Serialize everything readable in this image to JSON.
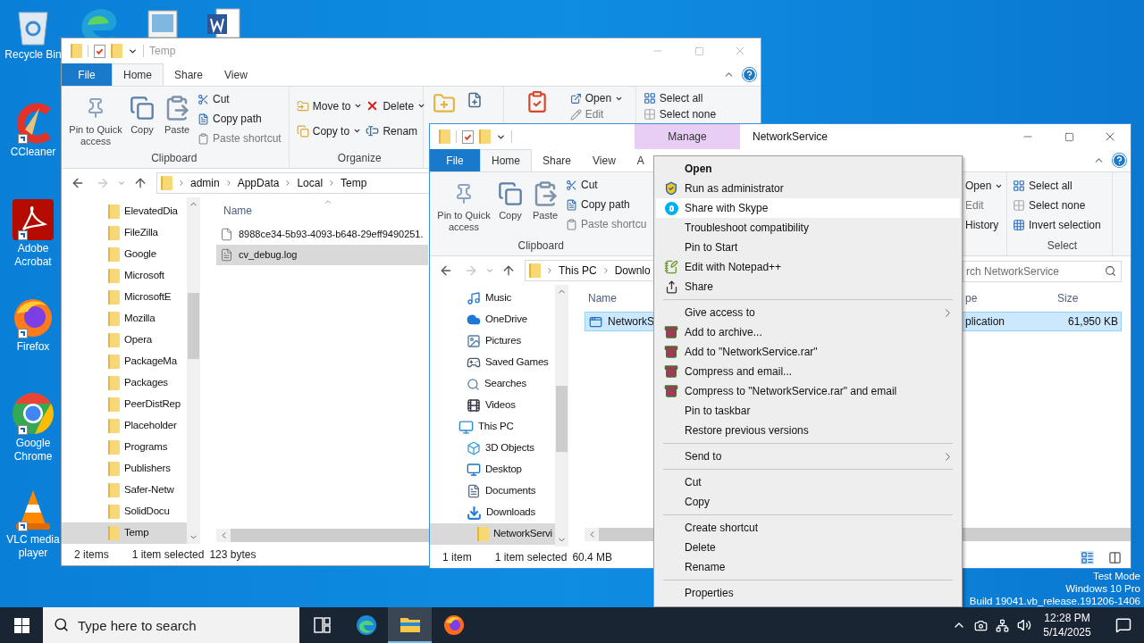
{
  "desktop_icons": [
    {
      "label": "Recycle Bin",
      "kind": "recycle"
    },
    {
      "label": "CCleaner",
      "kind": "ccleaner"
    },
    {
      "label": "Adobe Acrobat",
      "kind": "acrobat"
    },
    {
      "label": "Firefox",
      "kind": "firefox"
    },
    {
      "label": "Google Chrome",
      "kind": "chrome"
    },
    {
      "label": "VLC media player",
      "kind": "vlc"
    }
  ],
  "temp_window": {
    "title": "Temp",
    "tabs": [
      {
        "label": "File",
        "kind": "file",
        "selected": false
      },
      {
        "label": "Home",
        "kind": "tab",
        "selected": true
      },
      {
        "label": "Share",
        "kind": "tab",
        "selected": false
      },
      {
        "label": "View",
        "kind": "tab",
        "selected": false
      }
    ],
    "clipboard": {
      "large": [
        "Pin to Quick access",
        "Copy",
        "Paste"
      ],
      "small": [
        "Cut",
        "Copy path",
        "Paste shortcut"
      ],
      "label": "Clipboard"
    },
    "organize": {
      "items": [
        {
          "label": "Move to",
          "kind": "dropdown"
        },
        {
          "label": "Copy to",
          "kind": "dropdown"
        },
        {
          "label": "Delete",
          "kind": "dropdown"
        },
        {
          "label": "Renam",
          "kind": "button"
        }
      ],
      "label": "Organize"
    },
    "open": [
      {
        "label": "Open",
        "kind": "dropdown"
      },
      {
        "label": "Edit",
        "kind": "button"
      }
    ],
    "select": [
      "Select all",
      "Select none"
    ],
    "path": [
      "admin",
      "AppData",
      "Local",
      "Temp"
    ],
    "nav": [
      {
        "label": "ElevatedDia",
        "selected": false
      },
      {
        "label": "FileZilla",
        "selected": false
      },
      {
        "label": "Google",
        "selected": false
      },
      {
        "label": "Microsoft",
        "selected": false
      },
      {
        "label": "MicrosoftE",
        "selected": false
      },
      {
        "label": "Mozilla",
        "selected": false
      },
      {
        "label": "Opera",
        "selected": false
      },
      {
        "label": "PackageMa",
        "selected": false
      },
      {
        "label": "Packages",
        "selected": false
      },
      {
        "label": "PeerDistRep",
        "selected": false
      },
      {
        "label": "Placeholder",
        "selected": false
      },
      {
        "label": "Programs",
        "selected": false
      },
      {
        "label": "Publishers",
        "selected": false
      },
      {
        "label": "Safer-Netw",
        "selected": false
      },
      {
        "label": "SolidDocu",
        "selected": false
      },
      {
        "label": "Temp",
        "selected": true
      }
    ],
    "column": "Name",
    "files": [
      {
        "name": "8988ce34-5b93-4093-b648-29eff9490251.",
        "kind": "blank",
        "selected": false
      },
      {
        "name": "cv_debug.log",
        "kind": "text",
        "selected": true
      }
    ],
    "status": [
      "2 items",
      "1 item selected",
      "123 bytes"
    ]
  },
  "network_window": {
    "title": "NetworkService",
    "context_tab": "Manage",
    "tabs": [
      {
        "label": "File",
        "kind": "file",
        "selected": false
      },
      {
        "label": "Home",
        "kind": "tab",
        "selected": true
      },
      {
        "label": "Share",
        "kind": "tab",
        "selected": false
      },
      {
        "label": "View",
        "kind": "tab",
        "selected": false
      },
      {
        "label": "A",
        "kind": "tab",
        "selected": false
      }
    ],
    "clipboard": {
      "large": [
        "Pin to Quick access",
        "Copy",
        "Paste"
      ],
      "small": [
        "Cut",
        "Copy path",
        "Paste shortcu"
      ],
      "label": "Clipboard"
    },
    "open": [
      {
        "label": "Open",
        "kind": "dropdown"
      },
      {
        "label": "Edit",
        "kind": "button"
      },
      {
        "label": "History",
        "kind": "button"
      }
    ],
    "select": {
      "items": [
        "Select all",
        "Select none",
        "Invert selection"
      ],
      "label": "Select"
    },
    "path": [
      "This PC",
      "Downlo"
    ],
    "search": {
      "placeholder": "rch NetworkService"
    },
    "nav": [
      {
        "label": "Music",
        "kind": "music"
      },
      {
        "label": "OneDrive",
        "kind": "onedrive"
      },
      {
        "label": "Pictures",
        "kind": "pictures"
      },
      {
        "label": "Saved Games",
        "kind": "games"
      },
      {
        "label": "Searches",
        "kind": "searches"
      },
      {
        "label": "Videos",
        "kind": "videos"
      },
      {
        "label": "This PC",
        "kind": "pc",
        "children": [
          {
            "label": "3D Objects",
            "kind": "objects"
          },
          {
            "label": "Desktop",
            "kind": "desktop"
          },
          {
            "label": "Documents",
            "kind": "documents"
          },
          {
            "label": "Downloads",
            "kind": "downloads",
            "children": [
              {
                "label": "NetworkServi",
                "kind": "folder",
                "selected": true
              }
            ]
          }
        ]
      }
    ],
    "columns": [
      "Name",
      "pe",
      "Size"
    ],
    "rows": [
      {
        "cells": [
          "NetworkS",
          "plication",
          "61,950 KB"
        ],
        "selected": true
      }
    ],
    "status": [
      "1 item",
      "1 item selected",
      "60.4 MB"
    ]
  },
  "context_menu": [
    {
      "label": "Open",
      "kind": "default",
      "selected": false
    },
    {
      "label": "Run as administrator",
      "kind": "shield",
      "selected": false
    },
    {
      "label": "Share with Skype",
      "kind": "skype",
      "selected": true
    },
    {
      "label": "Troubleshoot compatibility",
      "kind": "item",
      "selected": false
    },
    {
      "label": "Pin to Start",
      "kind": "item",
      "selected": false
    },
    {
      "label": "Edit with Notepad++",
      "kind": "notepad",
      "selected": false
    },
    {
      "label": "Share",
      "kind": "share",
      "selected": false
    },
    {
      "kind": "separator"
    },
    {
      "label": "Give access to",
      "kind": "submenu",
      "selected": false
    },
    {
      "label": "Add to archive...",
      "kind": "rar",
      "selected": false
    },
    {
      "label": "Add to \"NetworkService.rar\"",
      "kind": "rar",
      "selected": false
    },
    {
      "label": "Compress and email...",
      "kind": "rar",
      "selected": false
    },
    {
      "label": "Compress to \"NetworkService.rar\" and email",
      "kind": "rar",
      "selected": false
    },
    {
      "label": "Pin to taskbar",
      "kind": "item",
      "selected": false
    },
    {
      "label": "Restore previous versions",
      "kind": "item",
      "selected": false
    },
    {
      "kind": "separator"
    },
    {
      "label": "Send to",
      "kind": "submenu",
      "selected": false
    },
    {
      "kind": "separator"
    },
    {
      "label": "Cut",
      "kind": "item",
      "selected": false
    },
    {
      "label": "Copy",
      "kind": "item",
      "selected": false
    },
    {
      "kind": "separator"
    },
    {
      "label": "Create shortcut",
      "kind": "item",
      "selected": false
    },
    {
      "label": "Delete",
      "kind": "item",
      "selected": false
    },
    {
      "label": "Rename",
      "kind": "item",
      "selected": false
    },
    {
      "kind": "separator"
    },
    {
      "label": "Properties",
      "kind": "item",
      "selected": false
    }
  ],
  "os_notice": [
    "Test Mode",
    "Windows 10 Pro",
    "Build 19041.vb_release.191206-1406"
  ],
  "taskbar": {
    "search": {
      "placeholder": "Type here to search"
    },
    "apps": [
      {
        "kind": "taskview",
        "selected": false
      },
      {
        "kind": "edge",
        "selected": false
      },
      {
        "kind": "explorer",
        "selected": true
      },
      {
        "kind": "firefox",
        "selected": false
      }
    ],
    "time": "12:28 PM",
    "date": "5/14/2025"
  }
}
